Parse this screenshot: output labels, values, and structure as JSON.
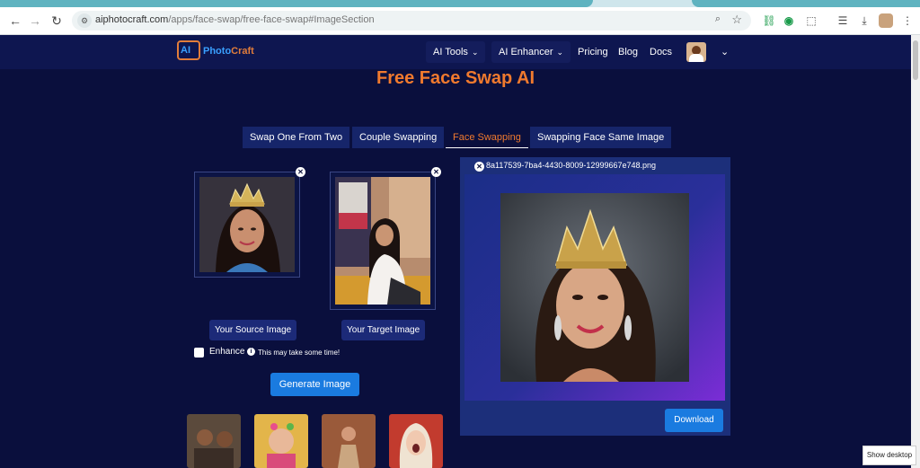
{
  "browser": {
    "url_host": "aiphotocraft.com",
    "url_path": "/apps/face-swap/free-face-swap#ImageSection",
    "back_icon": "arrow-left-icon",
    "forward_icon": "arrow-right-icon",
    "reload_icon": "reload-icon"
  },
  "site": {
    "logo_box": "AI",
    "logo_text_a": "Photo",
    "logo_text_b": "Craft",
    "nav": {
      "ai_tools": "AI Tools",
      "ai_enhancer": "AI Enhancer",
      "pricing": "Pricing",
      "blog": "Blog",
      "docs": "Docs"
    }
  },
  "page": {
    "title": "Free Face Swap AI",
    "tabs": [
      "Swap One From Two",
      "Couple Swapping",
      "Face Swapping",
      "Swapping Face Same Image"
    ],
    "active_tab": "Face Swapping",
    "source_label": "Your Source Image",
    "target_label": "Your Target Image",
    "enhance_label": "Enhance",
    "enhance_note": "This may take some time!",
    "generate_label": "Generate Image",
    "result_filename": "8a117539-7ba4-4430-8009-12999667e748.png",
    "download_label": "Download"
  },
  "os": {
    "show_desktop": "Show desktop"
  },
  "colors": {
    "accent_orange": "#f07a2e",
    "primary_blue": "#1a7be0",
    "background": "#0a0f3d"
  }
}
